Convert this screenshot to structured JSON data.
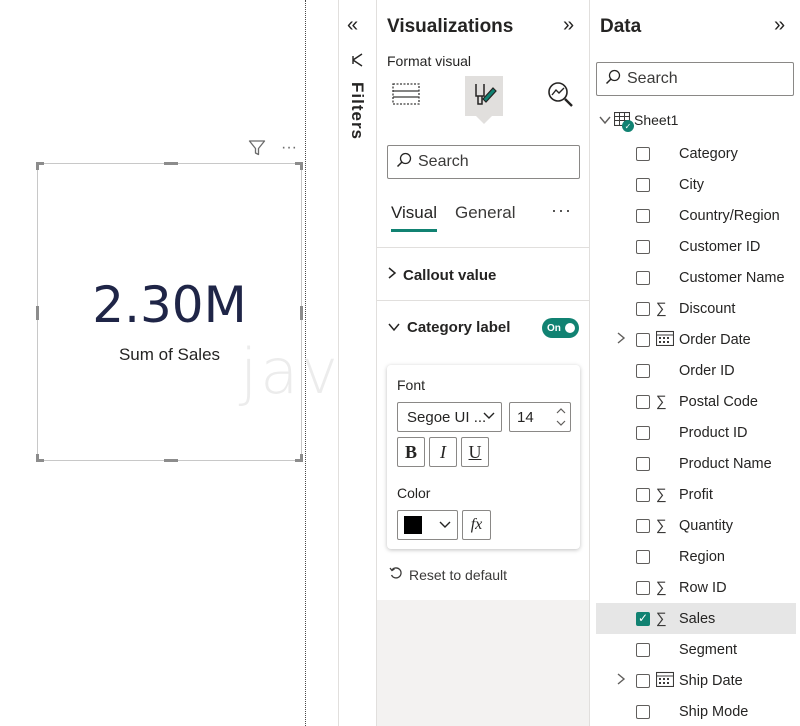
{
  "canvas": {
    "card": {
      "callout_value": "2.30M",
      "category_label": "Sum of Sales"
    },
    "header_icons": [
      "filter-icon",
      "more-options-icon"
    ],
    "more_glyph": "···",
    "watermark_text": "javaTpoint"
  },
  "filters_pane": {
    "label": "Filters",
    "collapse_glyph": "«"
  },
  "visualizations_pane": {
    "title": "Visualizations",
    "expand_glyph": "»",
    "format_visual_label": "Format visual",
    "search_placeholder": "Search",
    "tabs": {
      "visual": "Visual",
      "general": "General",
      "more": "···"
    },
    "sections": {
      "callout_value": "Callout value",
      "category_label": "Category label",
      "category_label_toggle": "On"
    },
    "category_label_settings": {
      "font_label": "Font",
      "font_family": "Segoe UI ...",
      "font_size": "14",
      "bold_glyph": "B",
      "italic_glyph": "I",
      "underline_glyph": "U",
      "color_label": "Color",
      "color_value": "#000000",
      "fx_glyph": "fx"
    },
    "reset_label": "Reset to default"
  },
  "data_pane": {
    "title": "Data",
    "expand_glyph": "»",
    "search_placeholder": "Search",
    "table_name": "Sheet1",
    "fields": [
      {
        "label": "Category",
        "icon": "",
        "expandable": false,
        "checked": false
      },
      {
        "label": "City",
        "icon": "",
        "expandable": false,
        "checked": false
      },
      {
        "label": "Country/Region",
        "icon": "",
        "expandable": false,
        "checked": false
      },
      {
        "label": "Customer ID",
        "icon": "",
        "expandable": false,
        "checked": false
      },
      {
        "label": "Customer Name",
        "icon": "",
        "expandable": false,
        "checked": false
      },
      {
        "label": "Discount",
        "icon": "sigma-icon",
        "expandable": false,
        "checked": false
      },
      {
        "label": "Order Date",
        "icon": "calendar-icon",
        "expandable": true,
        "checked": false
      },
      {
        "label": "Order ID",
        "icon": "",
        "expandable": false,
        "checked": false
      },
      {
        "label": "Postal Code",
        "icon": "sigma-icon",
        "expandable": false,
        "checked": false
      },
      {
        "label": "Product ID",
        "icon": "",
        "expandable": false,
        "checked": false
      },
      {
        "label": "Product Name",
        "icon": "",
        "expandable": false,
        "checked": false
      },
      {
        "label": "Profit",
        "icon": "sigma-icon",
        "expandable": false,
        "checked": false
      },
      {
        "label": "Quantity",
        "icon": "sigma-icon",
        "expandable": false,
        "checked": false
      },
      {
        "label": "Region",
        "icon": "",
        "expandable": false,
        "checked": false
      },
      {
        "label": "Row ID",
        "icon": "sigma-icon",
        "expandable": false,
        "checked": false
      },
      {
        "label": "Sales",
        "icon": "sigma-icon",
        "expandable": false,
        "checked": true
      },
      {
        "label": "Segment",
        "icon": "",
        "expandable": false,
        "checked": false
      },
      {
        "label": "Ship Date",
        "icon": "calendar-icon",
        "expandable": true,
        "checked": false
      },
      {
        "label": "Ship Mode",
        "icon": "",
        "expandable": false,
        "checked": false
      }
    ]
  },
  "colors": {
    "accent": "#118272",
    "callout_text": "#1f2547",
    "pane_bg": "#f3f2f1"
  }
}
